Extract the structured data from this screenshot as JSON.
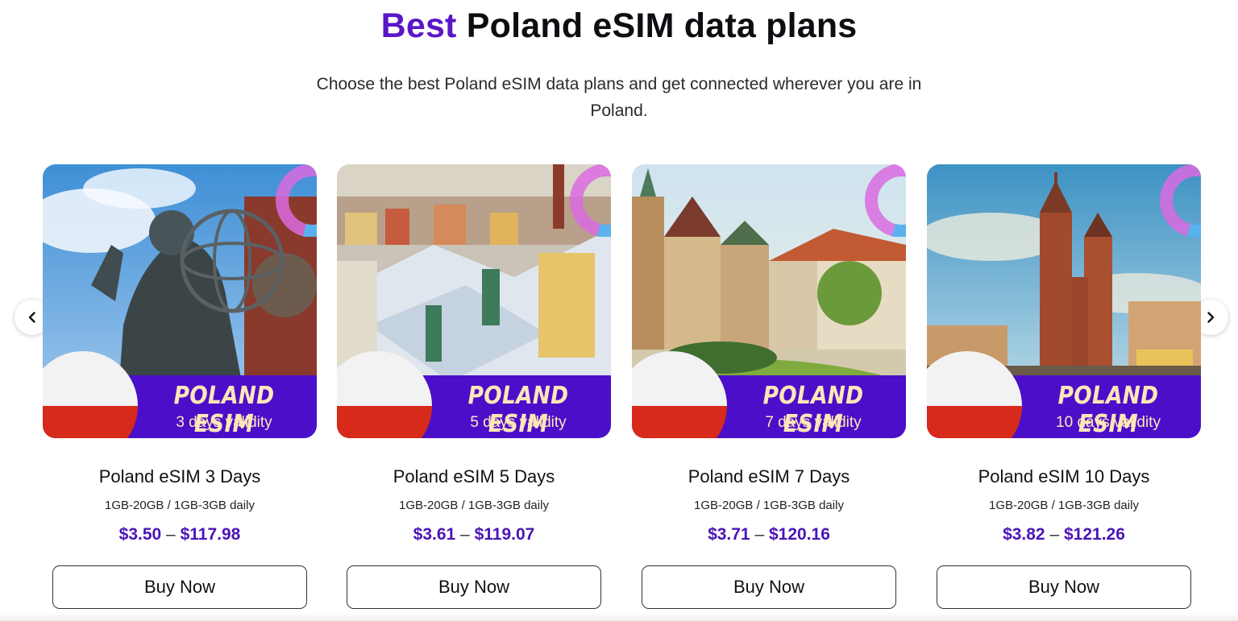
{
  "header": {
    "title_accent": "Best",
    "title_rest": "Poland eSIM data plans",
    "subtitle": "Choose the best Poland eSIM data plans and get connected wherever you are in Poland."
  },
  "carousel": {
    "prev_icon": "chevron-left-icon",
    "next_icon": "chevron-right-icon"
  },
  "colors": {
    "accent": "#5a16c8",
    "price": "#4a14b8",
    "banner": "#4b0fc9",
    "flag_red": "#d72a1b",
    "banner_text": "#ffe6b8"
  },
  "plans": [
    {
      "image_banner": "POLAND ESIM",
      "validity": "3 days validity",
      "title": "Poland eSIM 3 Days",
      "data": "1GB-20GB / 1GB-3GB daily",
      "price_low": "$3.50",
      "price_sep": "–",
      "price_high": "$117.98",
      "button": "Buy Now"
    },
    {
      "image_banner": "POLAND ESIM",
      "validity": "5 days validity",
      "title": "Poland eSIM 5 Days",
      "data": "1GB-20GB / 1GB-3GB daily",
      "price_low": "$3.61",
      "price_sep": "–",
      "price_high": "$119.07",
      "button": "Buy Now"
    },
    {
      "image_banner": "POLAND ESIM",
      "validity": "7 days validity",
      "title": "Poland eSIM 7 Days",
      "data": "1GB-20GB / 1GB-3GB daily",
      "price_low": "$3.71",
      "price_sep": "–",
      "price_high": "$120.16",
      "button": "Buy Now"
    },
    {
      "image_banner": "POLAND ESIM",
      "validity": "10 days validity",
      "title": "Poland eSIM 10 Days",
      "data": "1GB-20GB / 1GB-3GB daily",
      "price_low": "$3.82",
      "price_sep": "–",
      "price_high": "$121.26",
      "button": "Buy Now"
    }
  ]
}
